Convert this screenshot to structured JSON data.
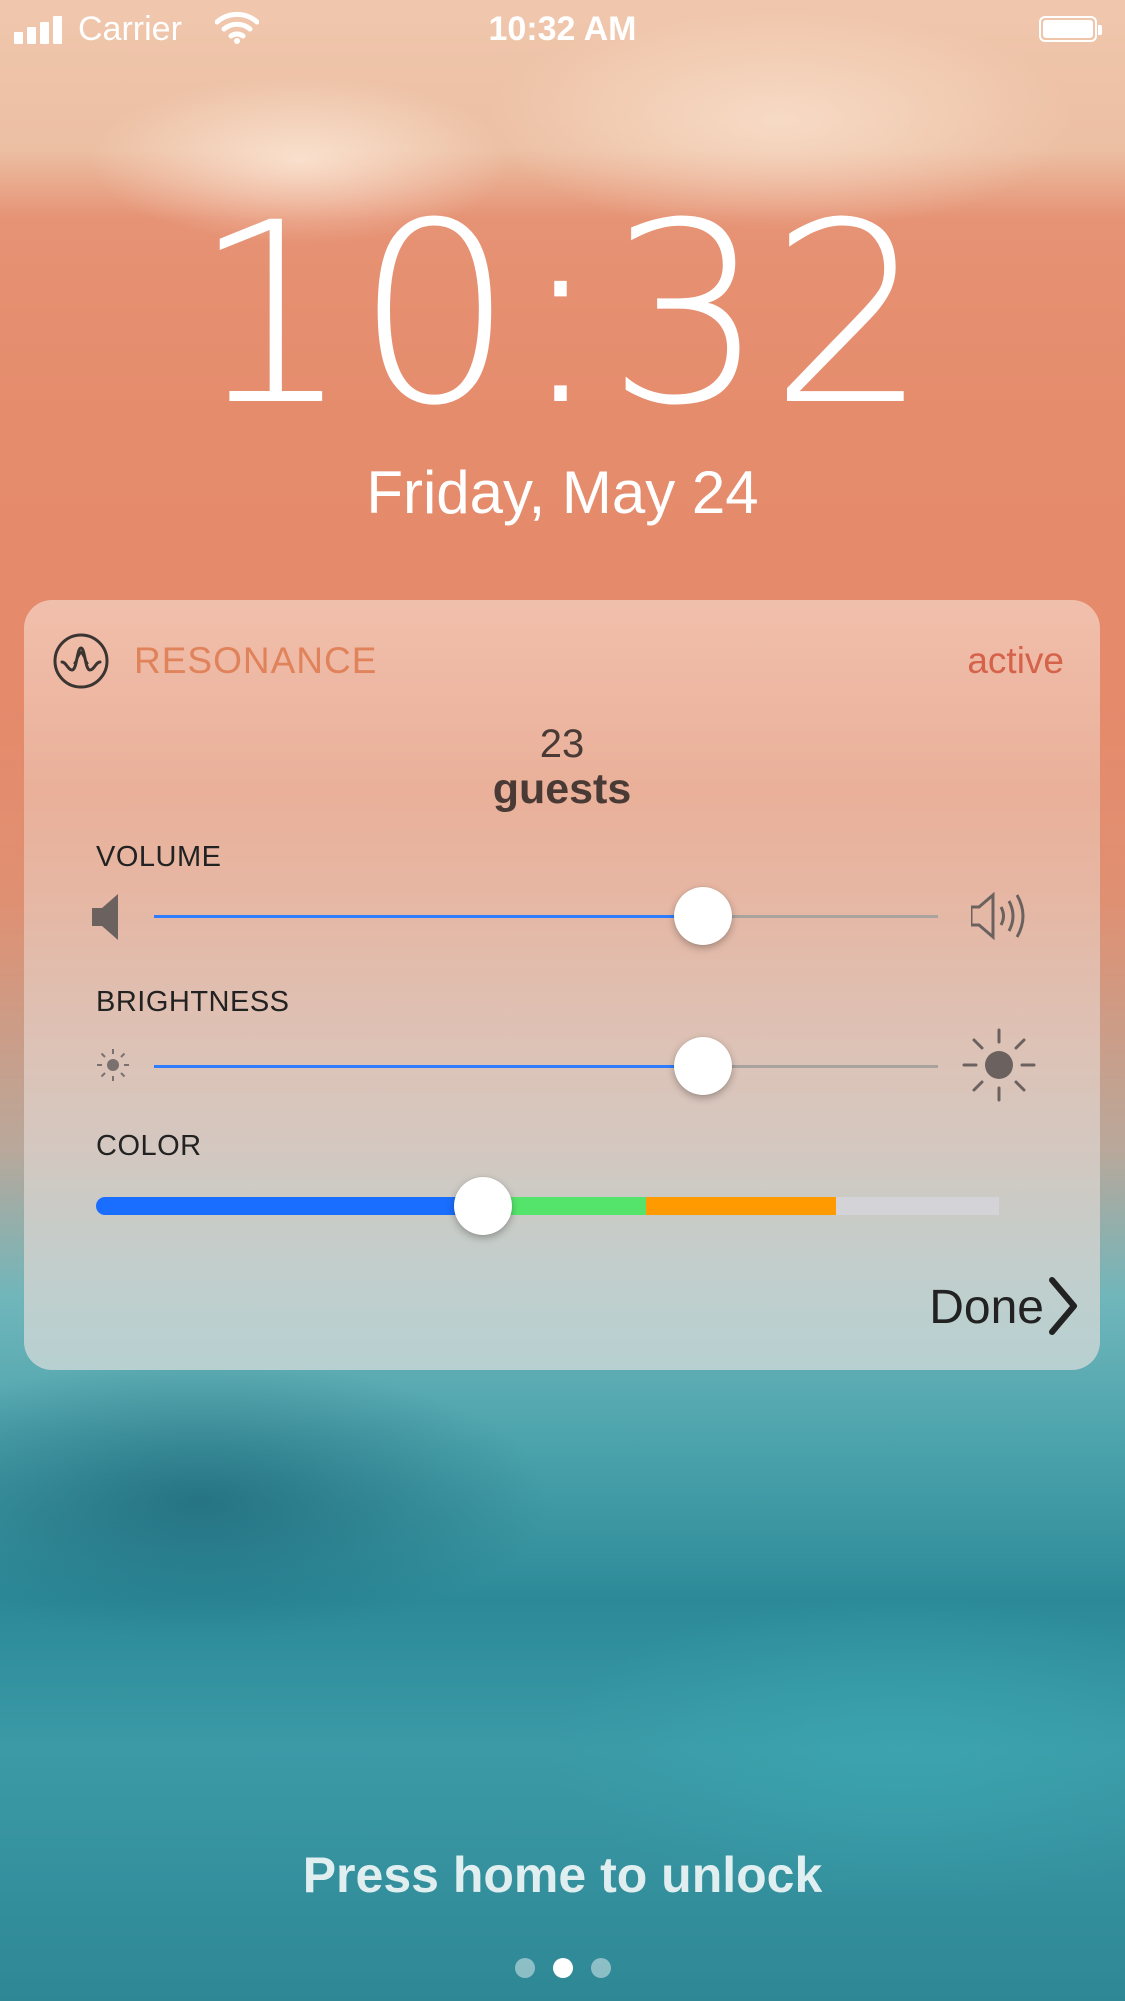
{
  "status_bar": {
    "carrier": "Carrier",
    "time": "10:32 AM",
    "icons": [
      "signal-icon",
      "wifi-icon",
      "battery-icon"
    ]
  },
  "lock_screen": {
    "clock": "10:32",
    "date": "Friday, May 24",
    "unlock_hint": "Press home to unlock",
    "page_dots": {
      "count": 3,
      "active_index": 1
    }
  },
  "widget": {
    "app_name": "RESONANCE",
    "status": "active",
    "guests_count": "23",
    "guests_label": "guests",
    "volume": {
      "label": "VOLUME",
      "value": 0.7,
      "min_icon": "speaker-low-icon",
      "max_icon": "speaker-high-icon"
    },
    "brightness": {
      "label": "BRIGHTNESS",
      "value": 0.7,
      "min_icon": "sun-small-icon",
      "max_icon": "sun-large-icon"
    },
    "color": {
      "label": "COLOR",
      "value": 0.415,
      "segments": [
        {
          "name": "blue",
          "color": "#1a6eff",
          "fraction": 0.415
        },
        {
          "name": "green",
          "color": "#55e46b",
          "fraction": 0.17
        },
        {
          "name": "orange",
          "color": "#ff9a00",
          "fraction": 0.2
        },
        {
          "name": "gray",
          "color": "#d3d3d8",
          "fraction": 0.17
        }
      ]
    },
    "done_label": "Done"
  },
  "colors": {
    "accent": "#2f7dff",
    "app_name": "#e0825a",
    "status_active": "#d5624a"
  }
}
